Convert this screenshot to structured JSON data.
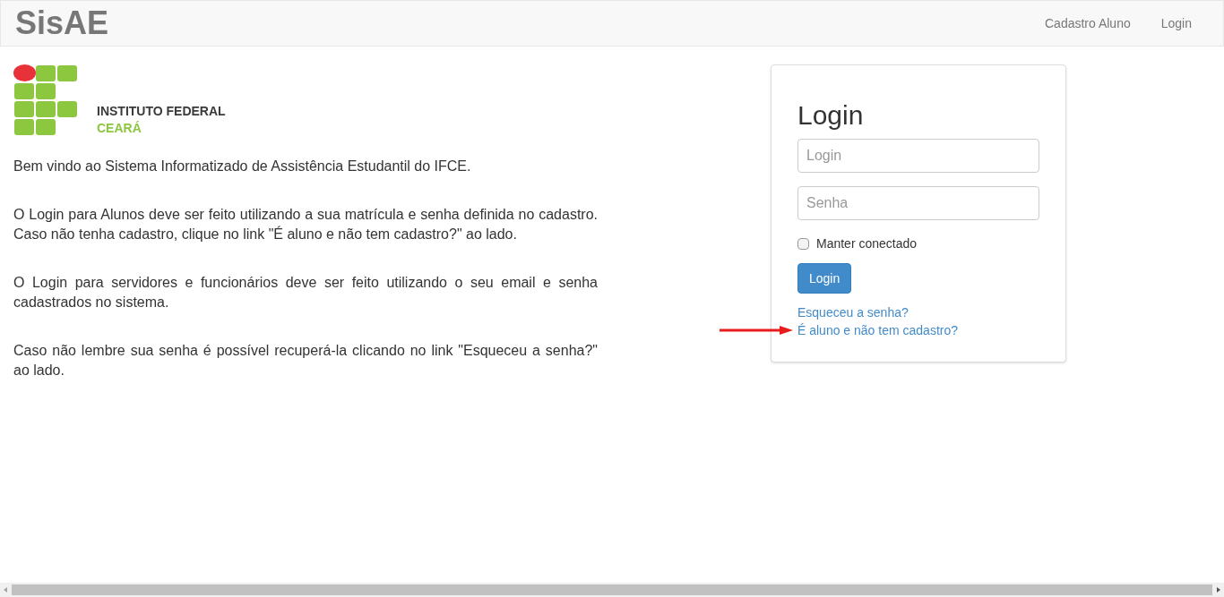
{
  "navbar": {
    "brand": "SisAE",
    "links": [
      {
        "label": "Cadastro Aluno"
      },
      {
        "label": "Login"
      }
    ]
  },
  "logo": {
    "line1": "INSTITUTO FEDERAL",
    "line2": "CEARÁ"
  },
  "paragraphs": [
    "Bem vindo ao Sistema Informatizado de Assistência Estudantil do IFCE.",
    "O Login para Alunos deve ser feito utilizando a sua matrícula e senha definida no cadastro. Caso não tenha cadastro, clique no link \"É aluno e não tem cadastro?\" ao lado.",
    "O Login para servidores e funcionários deve ser feito utilizando o seu email e senha cadastrados no sistema.",
    "Caso não lembre sua senha é possível recuperá-la clicando no link \"Esqueceu a senha?\" ao lado."
  ],
  "login_panel": {
    "title": "Login",
    "fields": [
      {
        "placeholder": "Login"
      },
      {
        "placeholder": "Senha"
      }
    ],
    "remember": {
      "label": "Manter conectado",
      "checked": false
    },
    "button": "Login",
    "links": [
      {
        "label": "Esqueceu a senha?",
        "arrow": false
      },
      {
        "label": "É aluno e não tem cadastro?",
        "arrow": true
      }
    ]
  }
}
